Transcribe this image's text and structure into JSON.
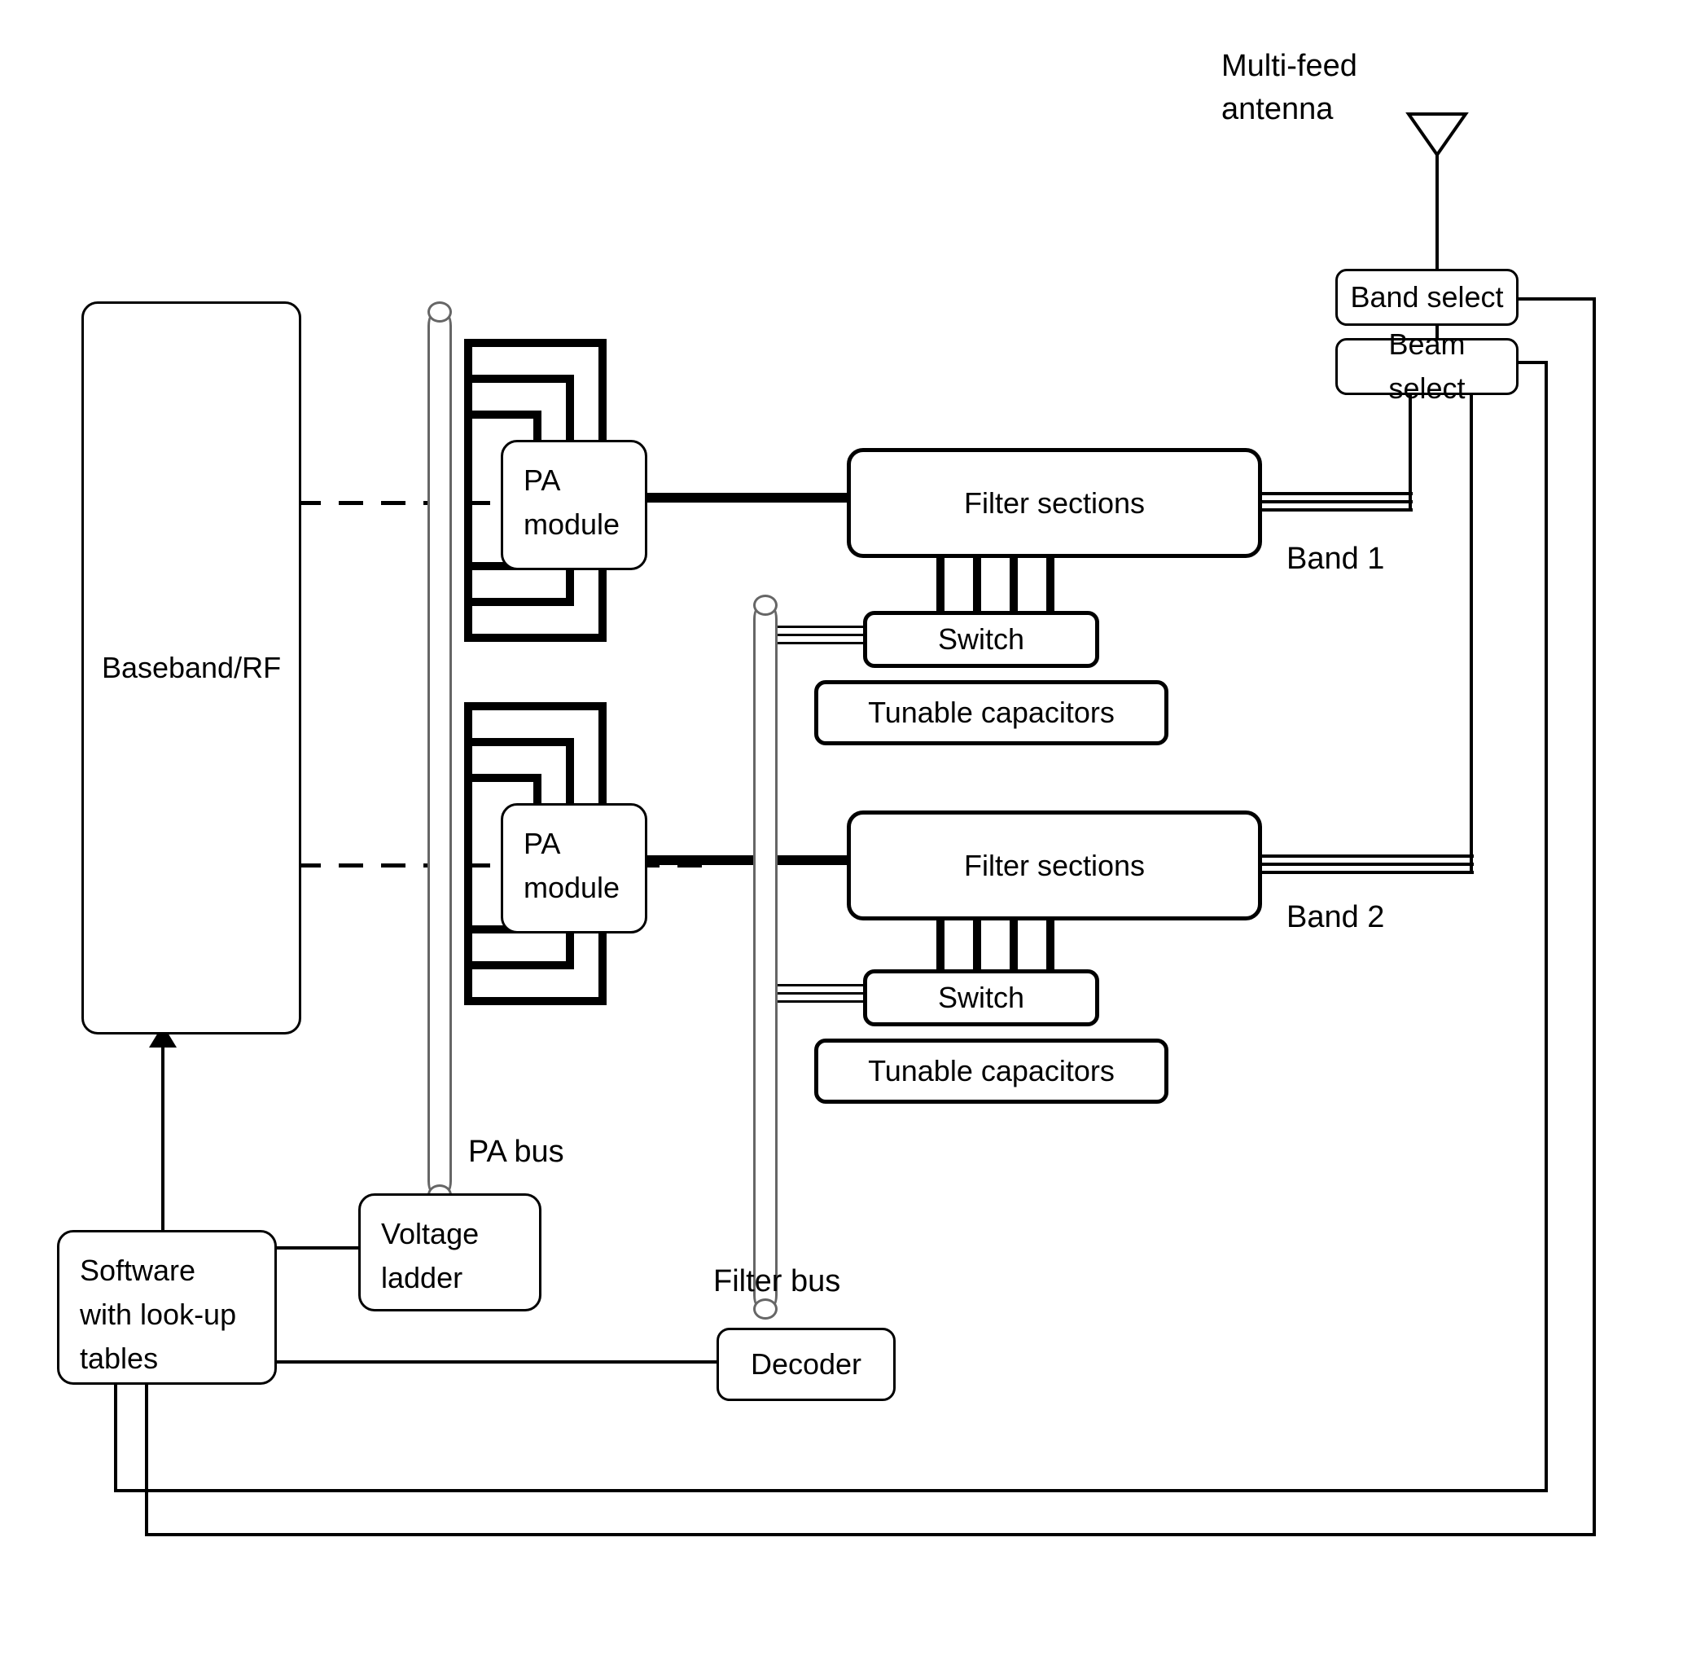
{
  "blocks": {
    "baseband": "Baseband/RF",
    "pa_module_1": "PA module",
    "pa_module_2": "PA module",
    "filter_sections_1": "Filter sections",
    "filter_sections_2": "Filter sections",
    "switch_1": "Switch",
    "switch_2": "Switch",
    "tunable_caps_1": "Tunable capacitors",
    "tunable_caps_2": "Tunable capacitors",
    "band_select": "Band select",
    "beam_select": "Beam select",
    "voltage_ladder": "Voltage ladder",
    "software": "Software with look-up tables",
    "decoder": "Decoder"
  },
  "labels": {
    "multi_feed_antenna": "Multi-feed antenna",
    "band1": "Band 1",
    "band2": "Band 2",
    "pa_bus": "PA bus",
    "filter_bus": "Filter bus"
  }
}
